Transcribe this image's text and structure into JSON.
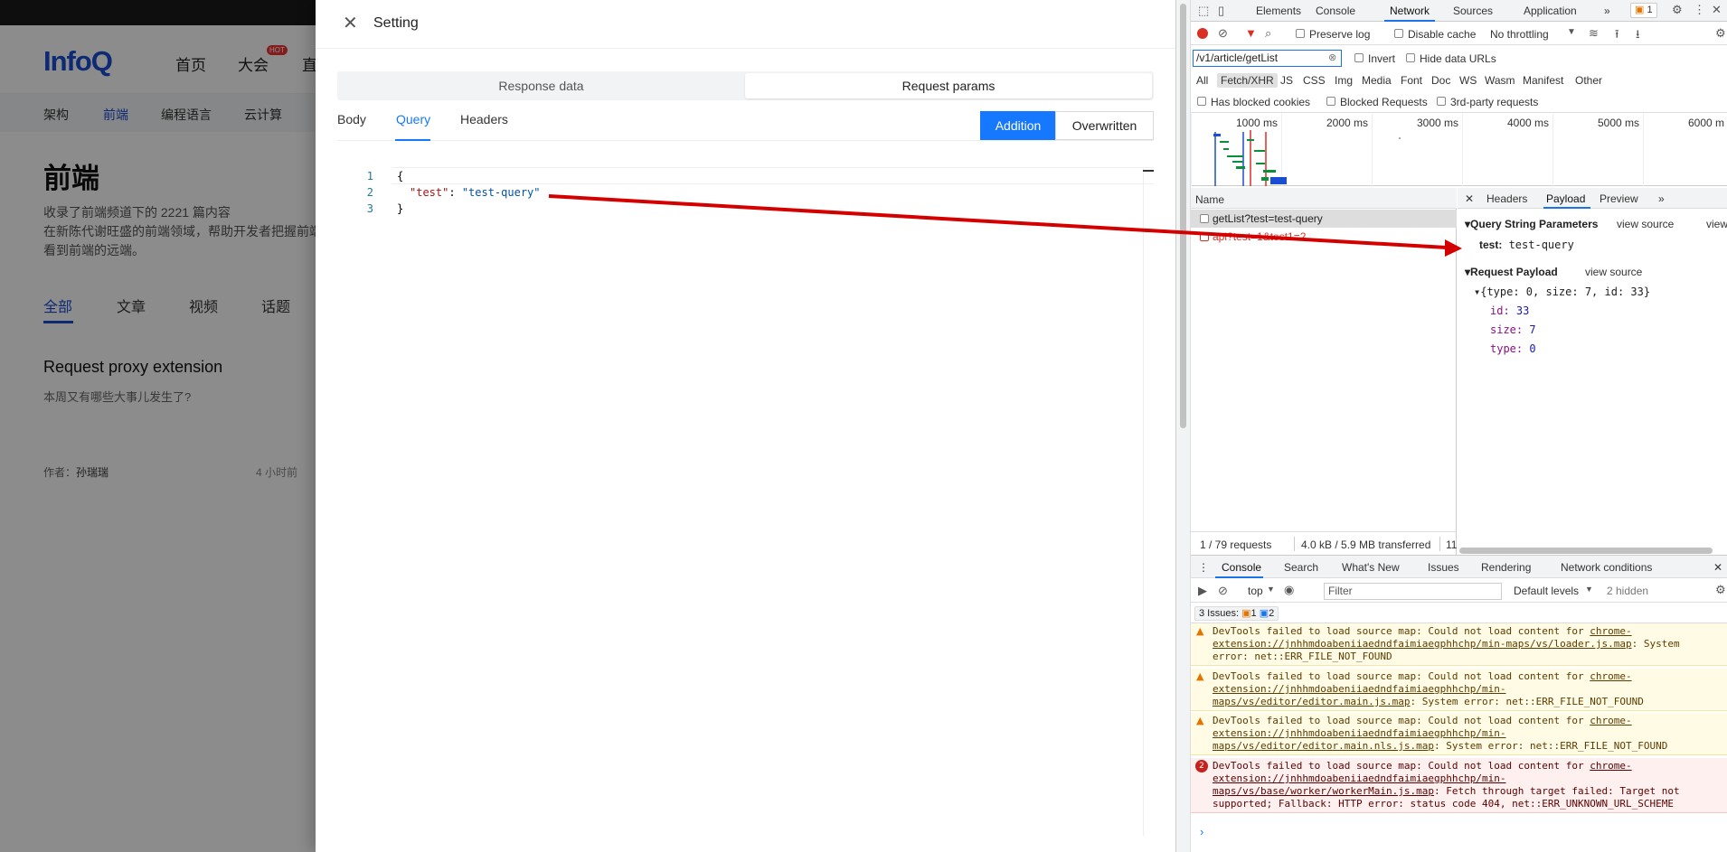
{
  "bg": {
    "logo": "InfoQ",
    "nav": [
      "首页",
      "大会",
      "直"
    ],
    "hot_badge": "HOT",
    "subnav": [
      "架构",
      "前端",
      "编程语言",
      "云计算"
    ],
    "title": "前端",
    "desc1": "收录了前端频道下的 2221 篇内容",
    "desc2": "在新陈代谢旺盛的前端领域，帮助开发者把握前端",
    "desc3": "看到前端的远端。",
    "tabs": [
      "全部",
      "文章",
      "视频",
      "话题"
    ],
    "article_title": "Request proxy extension",
    "article_sub": "本周又有哪些大事儿发生了?",
    "author_label": "作者：",
    "author": "孙瑞瑞",
    "time": "4 小时前"
  },
  "drawer": {
    "title": "Setting",
    "close_icon": "close-icon",
    "segments": [
      "Response data",
      "Request params"
    ],
    "tabs": [
      "Body",
      "Query",
      "Headers"
    ],
    "mode_buttons": [
      "Addition",
      "Overwritten"
    ],
    "line_numbers": [
      "1",
      "2",
      "3"
    ],
    "code_open": "{",
    "code_key": "\"test\"",
    "code_sep": ": ",
    "code_val": "\"test-query\"",
    "code_close": "}"
  },
  "devtools": {
    "tabs": [
      "Elements",
      "Console",
      "Network",
      "Sources",
      "Application"
    ],
    "more": "»",
    "issue_count": "1",
    "preserve_log": "Preserve log",
    "disable_cache": "Disable cache",
    "throttling": "No throttling",
    "filter_value": "/v1/article/getList",
    "invert": "Invert",
    "hide_data_urls": "Hide data URLs",
    "filter_types": [
      "All",
      "Fetch/XHR",
      "JS",
      "CSS",
      "Img",
      "Media",
      "Font",
      "Doc",
      "WS",
      "Wasm",
      "Manifest",
      "Other"
    ],
    "has_blocked_cookies": "Has blocked cookies",
    "blocked_requests": "Blocked Requests",
    "third_party": "3rd-party requests",
    "timeline_labels": [
      "1000 ms",
      "2000 ms",
      "3000 ms",
      "4000 ms",
      "5000 ms",
      "6000 m"
    ],
    "name_header": "Name",
    "requests": [
      {
        "name": "getList?test=test-query",
        "error": false
      },
      {
        "name": "api?test=1&test1=2",
        "error": true
      }
    ],
    "status_requests": "1 / 79 requests",
    "status_transferred": "4.0 kB / 5.9 MB transferred",
    "status_more": "11",
    "detail_tabs": [
      "Headers",
      "Payload",
      "Preview"
    ],
    "query_section": "Query String Parameters",
    "view_source": "view source",
    "view_cut": "view",
    "query_key": "test:",
    "query_val": "test-query",
    "payload_section": "Request Payload",
    "payload_summary": "{type: 0, size: 7, id: 33}",
    "payload": [
      {
        "k": "id:",
        "v": "33"
      },
      {
        "k": "size:",
        "v": "7"
      },
      {
        "k": "type:",
        "v": "0"
      }
    ],
    "drawer_tabs": [
      "Console",
      "Search",
      "What's New",
      "Issues",
      "Rendering",
      "Network conditions"
    ],
    "context": "top",
    "console_filter_placeholder": "Filter",
    "levels": "Default levels",
    "hidden": "2 hidden",
    "issues_label": "3 Issues:",
    "issues_warn": "1",
    "issues_info": "2",
    "error_count": "2",
    "messages": [
      {
        "prefix": "DevTools failed to load source map: Could not load content for ",
        "link": "chrome-extension://jnhhmdoabeniiaedndfaimiaegphhchp/min-maps/vs/loader.js.map",
        "suffix": ": System error: net::ERR_FILE_NOT_FOUND"
      },
      {
        "prefix": "DevTools failed to load source map: Could not load content for ",
        "link": "chrome-extension://jnhhmdoabeniiaedndfaimiaegphhchp/min-maps/vs/editor/editor.main.js.map",
        "suffix": ": System error: net::ERR_FILE_NOT_FOUND"
      },
      {
        "prefix": "DevTools failed to load source map: Could not load content for ",
        "link": "chrome-extension://jnhhmdoabeniiaedndfaimiaegphhchp/min-maps/vs/editor/editor.main.nls.js.map",
        "suffix": ": System error: net::ERR_FILE_NOT_FOUND"
      },
      {
        "prefix": "DevTools failed to load source map: Could not load content for ",
        "link": "chrome-extension://jnhhmdoabeniiaedndfaimiaegphhchp/min-maps/vs/base/worker/workerMain.js.map",
        "suffix": ": Fetch through target failed: Target not supported; Fallback: HTTP error: status code 404, net::ERR_UNKNOWN_URL_SCHEME"
      }
    ],
    "prompt": "›"
  },
  "colors": {
    "accent": "#1677ff",
    "arrow": "#d40000",
    "devtools_blue": "#1a73e8"
  }
}
